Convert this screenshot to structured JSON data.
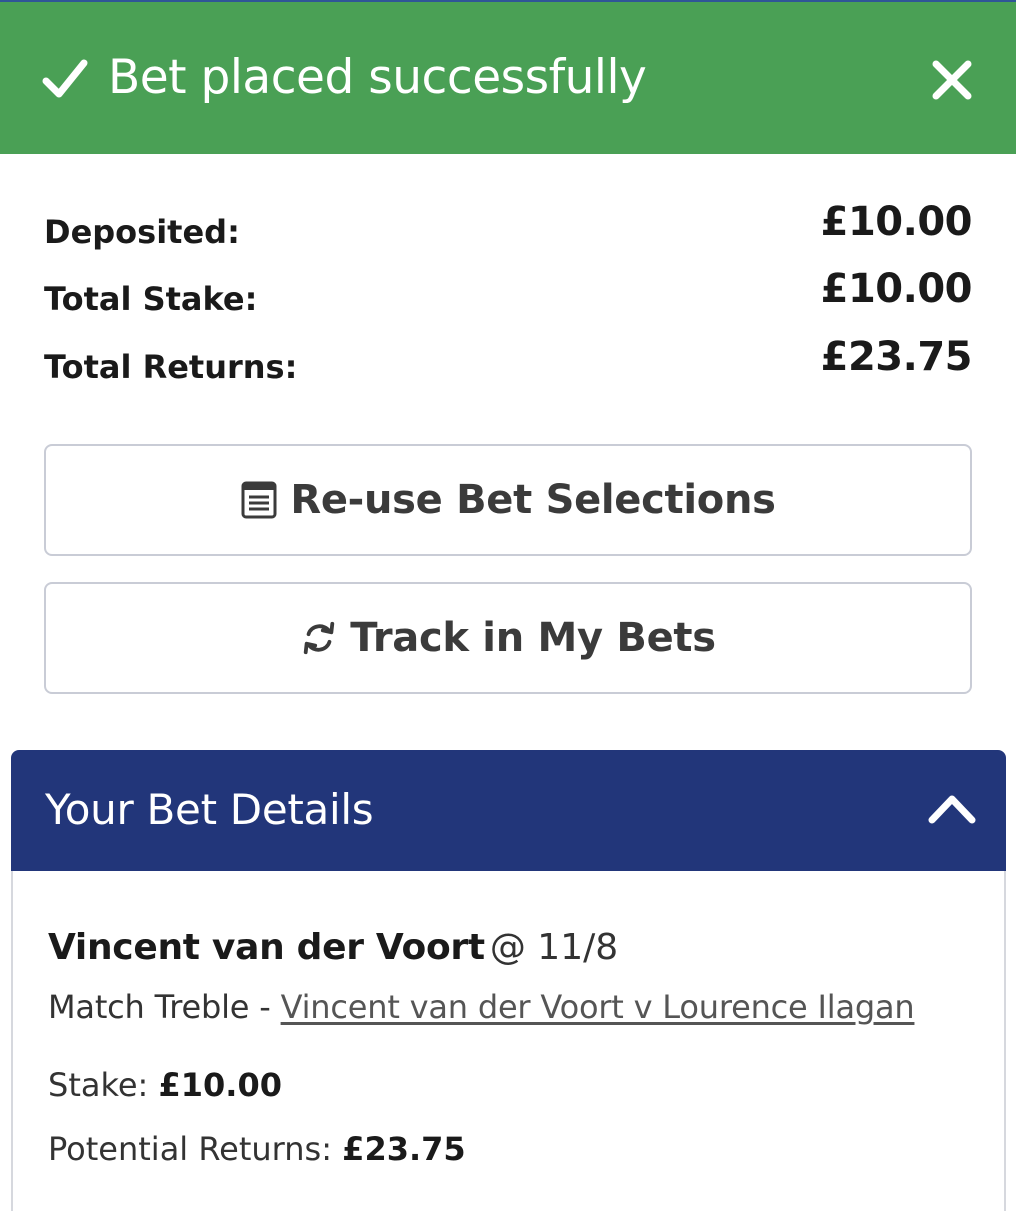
{
  "banner": {
    "title": "Bet placed successfully",
    "check_icon": "check-icon",
    "close_icon": "close-icon",
    "background_color": "#4aa055"
  },
  "summary": {
    "rows": [
      {
        "label": "Deposited:",
        "value": "£10.00"
      },
      {
        "label": "Total Stake:",
        "value": "£10.00"
      },
      {
        "label": "Total Returns:",
        "value": "£23.75"
      }
    ]
  },
  "actions": {
    "reuse_label": "Re-use Bet Selections",
    "reuse_icon": "document-list-icon",
    "track_label": "Track in My Bets",
    "track_icon": "refresh-icon"
  },
  "details": {
    "header_title": "Your Bet Details",
    "header_color": "#22367a",
    "chevron_icon": "chevron-up-icon",
    "selection_name": "Vincent van der Voort",
    "selection_odds": "@ 11/8",
    "market_prefix": "Match Treble - ",
    "event_link": "Vincent van der Voort v Lourence Ilagan",
    "stake_label": "Stake: ",
    "stake_value": "£10.00",
    "returns_label": "Potential Returns: ",
    "returns_value": "£23.75"
  }
}
